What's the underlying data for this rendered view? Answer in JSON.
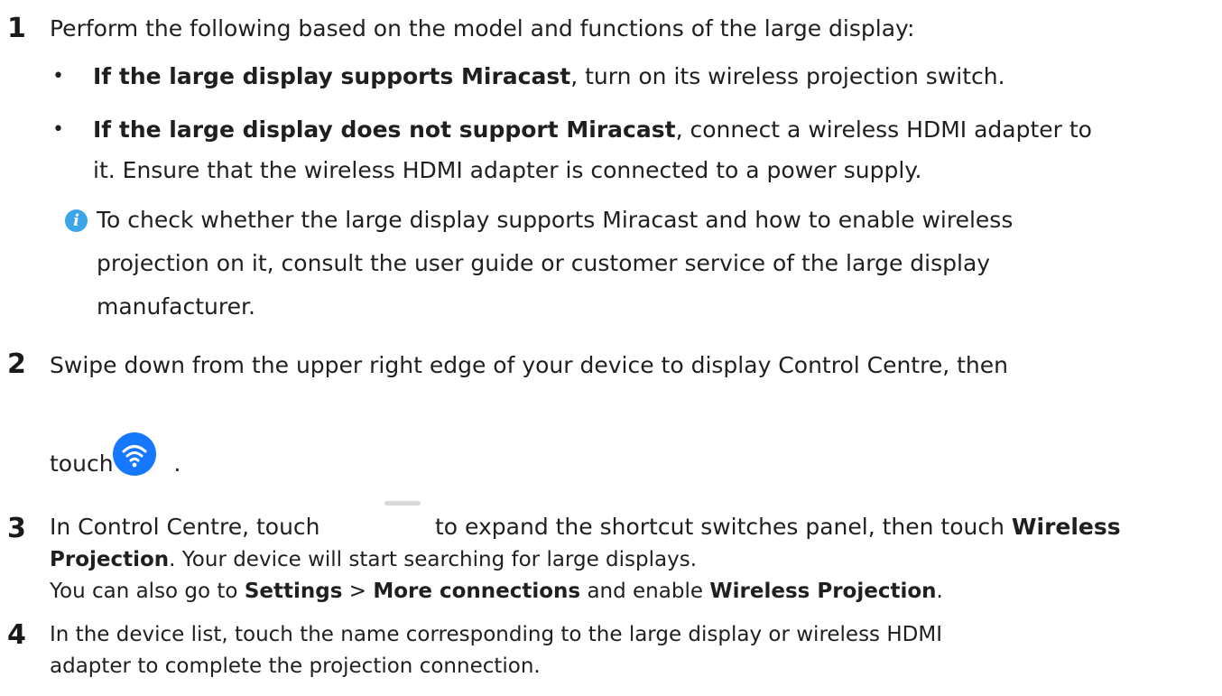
{
  "step1": {
    "number": "1",
    "text": "Perform the following based on the model and functions of the large display:",
    "bullet_glyph": "•",
    "bullet1": {
      "bold": "If the large display supports Miracast",
      "rest": ", turn on its wireless projection switch."
    },
    "bullet2": {
      "bold": "If the large display does not support Miracast",
      "rest": ", connect a wireless HDMI adapter to",
      "line2": "it. Ensure that the wireless HDMI adapter is connected to a power supply."
    },
    "note": {
      "icon_glyph": "i",
      "line1": "To check whether the large display supports Miracast and how to enable wireless",
      "line2": "projection on it, consult the user guide or customer service of the large display",
      "line3": "manufacturer."
    }
  },
  "step2": {
    "number": "2",
    "line1": "Swipe down from the upper right edge of your device to display Control Centre, then",
    "line2_before": "touch",
    "line2_after": "."
  },
  "step3": {
    "number": "3",
    "line1_before": "In Control Centre, touch",
    "line1_after": "to expand the shortcut switches panel, then touch",
    "line1_bold": "Wireless",
    "line2_bold": "Projection",
    "line2_rest": ". Your device will start searching for large displays.",
    "line3_a": "You can also go to",
    "line3_settings": "Settings",
    "line3_gt": ">",
    "line3_more": "More connections",
    "line3_b": "and enable",
    "line3_wp": "Wireless Projection",
    "line3_end": "."
  },
  "step4": {
    "number": "4",
    "line1": "In the device list, touch the name corresponding to the large display or wireless HDMI",
    "line2": "adapter to complete the projection connection."
  },
  "icons": {
    "info": "info-icon",
    "wireless_projection": "wifi-icon",
    "expand_handle": "expand-handle-icon"
  },
  "colors": {
    "text": "#1f1f1f",
    "info_icon": "#3aa5e8",
    "wifi_button": "#1677ff",
    "handle": "#d9d9d9"
  }
}
